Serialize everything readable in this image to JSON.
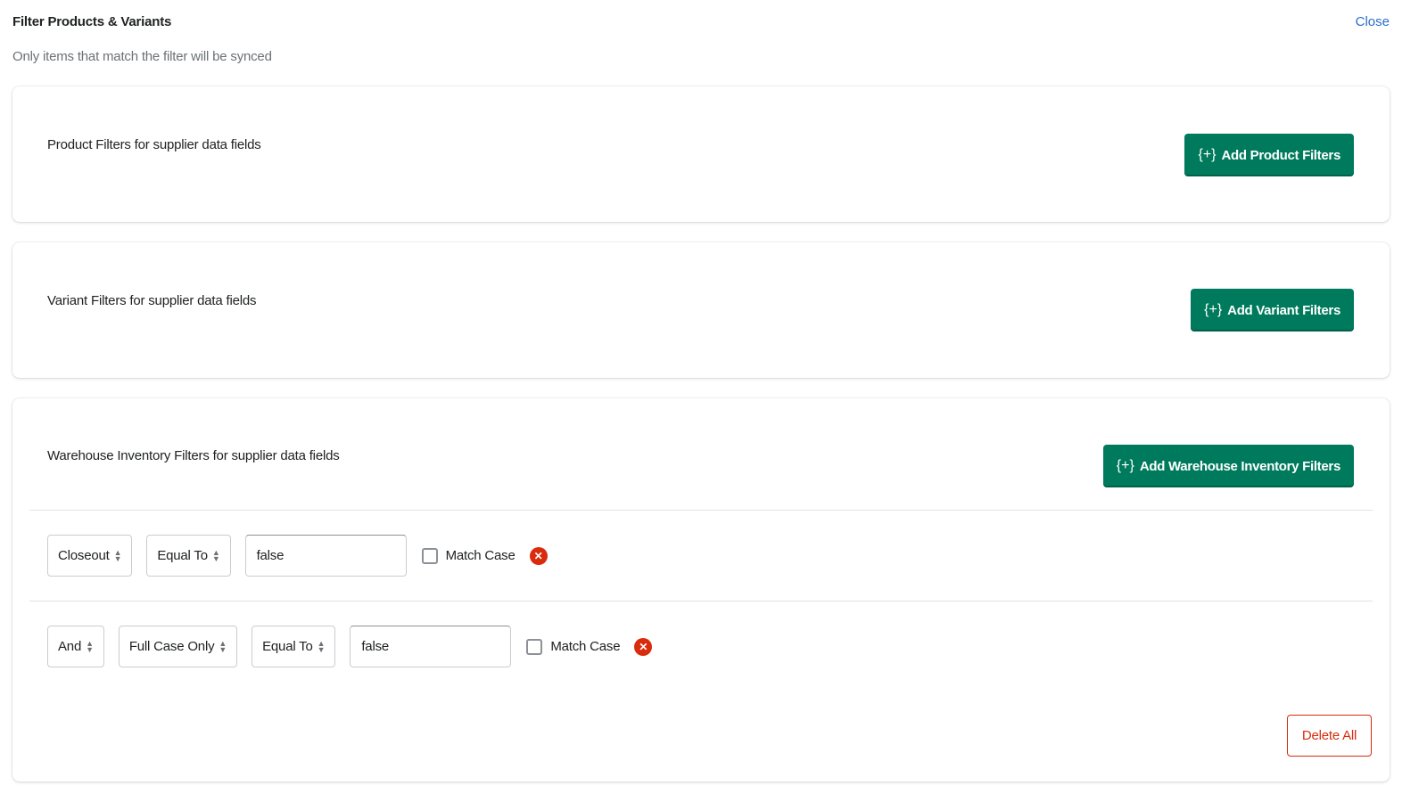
{
  "header": {
    "title": "Filter Products & Variants",
    "subtitle": "Only items that match the filter will be synced",
    "close_label": "Close"
  },
  "colors": {
    "primary": "#007a5c",
    "critical": "#d82c0d",
    "link": "#2c6ecb"
  },
  "sections": {
    "product": {
      "label": "Product Filters for supplier data fields",
      "button_icon": "{+}",
      "button_label": "Add Product Filters"
    },
    "variant": {
      "label": "Variant Filters for supplier data fields",
      "button_icon": "{+}",
      "button_label": "Add Variant Filters"
    },
    "warehouse": {
      "label": "Warehouse Inventory Filters for supplier data fields",
      "button_icon": "{+}",
      "button_label": "Add Warehouse Inventory Filters",
      "filters": [
        {
          "field": "Closeout",
          "operator": "Equal To",
          "value": "false",
          "match_case_label": "Match Case",
          "match_case": false
        },
        {
          "conjunction": "And",
          "field": "Full Case Only",
          "operator": "Equal To",
          "value": "false",
          "match_case_label": "Match Case",
          "match_case": false
        }
      ],
      "delete_all_label": "Delete All"
    }
  }
}
